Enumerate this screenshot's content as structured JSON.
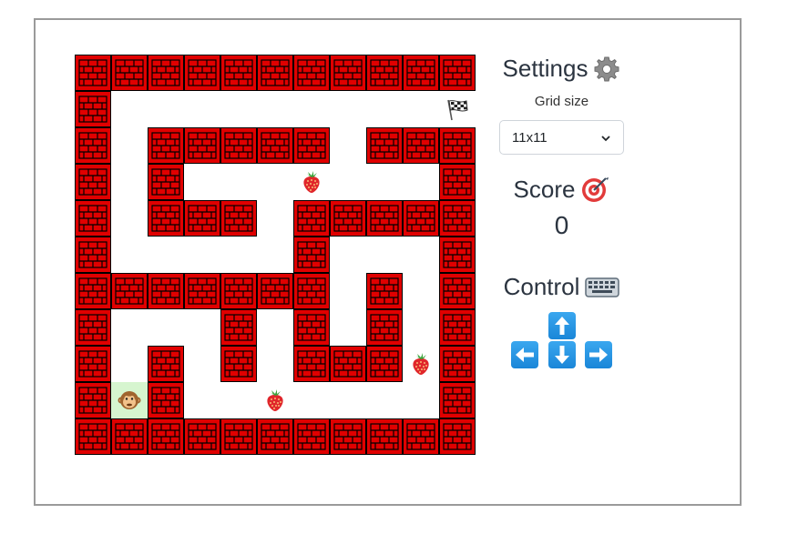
{
  "settings": {
    "title": "Settings",
    "icon": "gear-icon",
    "grid_size_label": "Grid size",
    "grid_size_value": "11x11"
  },
  "score": {
    "title": "Score",
    "icon": "target-icon",
    "value": "0"
  },
  "control": {
    "title": "Control",
    "icon": "keyboard-icon",
    "keys": [
      "arrow-up-key",
      "arrow-left-key",
      "arrow-down-key",
      "arrow-right-key"
    ]
  },
  "maze": {
    "rows": 11,
    "cols": 11,
    "grid": [
      "###########",
      "#.........F",
      "#.#####.###",
      "#.#...s...#",
      "#.###.#####",
      "#.....#...#",
      "#######.#.#",
      "#...#.#.#.#",
      "#.#.#.###s#",
      "#P#..s....#",
      "###########"
    ],
    "legend": {
      "#": "brick-wall",
      ".": "path",
      "P": "monkey-player",
      "s": "strawberry",
      "F": "finish-flag"
    },
    "colors": {
      "wall": "#e00000",
      "mortar": "#000000",
      "start_cell": "#d6f5cf",
      "path": "#ffffff"
    }
  }
}
